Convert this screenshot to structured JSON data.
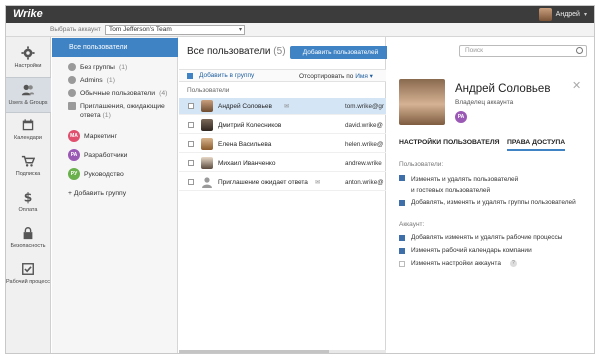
{
  "app": {
    "logo": "Wrike",
    "user_name": "Андрей",
    "account_label": "Выбрать аккаунт",
    "account_value": "Tom Jefferson's Team",
    "search_placeholder": "Поиск"
  },
  "nav": [
    {
      "label": "Настройки",
      "icon": "gear-icon"
    },
    {
      "label": "Users & Groups",
      "icon": "users-icon"
    },
    {
      "label": "Календари",
      "icon": "calendar-icon"
    },
    {
      "label": "Подписка",
      "icon": "cart-icon"
    },
    {
      "label": "Оплата",
      "icon": "dollar-icon"
    },
    {
      "label": "Безопасность",
      "icon": "lock-icon"
    },
    {
      "label": "Рабочий процесс",
      "icon": "checkbox-icon"
    }
  ],
  "groups": {
    "all": "Все пользователи",
    "items": [
      {
        "label": "Без группы",
        "count": "(1)"
      },
      {
        "label": "Admins",
        "count": "(1)"
      },
      {
        "label": "Обычные пользователи",
        "count": "(4)"
      },
      {
        "label": "Приглашения, ожидающие",
        "label2": "ответа",
        "count": "(1)"
      }
    ],
    "named": [
      {
        "badge": "МА",
        "label": "Маркетинг",
        "color": "#e0506e"
      },
      {
        "badge": "РА",
        "label": "Разработчики",
        "color": "#9b59b6"
      },
      {
        "badge": "РУ",
        "label": "Руководство",
        "color": "#6ab04c"
      }
    ],
    "add": "+ Добавить группу"
  },
  "users": {
    "title": "Все пользователи",
    "count": "(5)",
    "add_button": "Добавить пользователей",
    "add_to_group": "Добавить в группу",
    "sort_label": "Отсортировать по",
    "sort_value": "Имя ▾",
    "list_header": "Пользователи",
    "rows": [
      {
        "name": "Андрей Соловьев",
        "email": "tom.wrike@gr",
        "mail": "✉"
      },
      {
        "name": "Дмитрий Колесников",
        "email": "david.wrike@",
        "mail": ""
      },
      {
        "name": "Елена Васильева",
        "email": "helen.wrike@",
        "mail": ""
      },
      {
        "name": "Михаил Иванченко",
        "email": "andrew.wrike",
        "mail": ""
      },
      {
        "name": "Приглашение ожидает ответа",
        "email": "anton.wrike@",
        "mail": "✉"
      }
    ]
  },
  "detail": {
    "name": "Андрей Соловьев",
    "role": "Владелец аккаунта",
    "badge": "РА",
    "badge_color": "#9b59b6",
    "tab_settings": "НАСТРОЙКИ ПОЛЬЗОВАТЕЛЯ",
    "tab_access": "ПРАВА ДОСТУПА",
    "users_section": "Пользователи:",
    "account_section": "Аккаунт:",
    "user_perms": [
      {
        "line1": "Изменять и удалять пользователей",
        "line2": "и гостевых пользователей",
        "on": true
      },
      {
        "line1": "Добавлять, изменять и удалять группы пользователей",
        "line2": "",
        "on": true
      }
    ],
    "account_perms": [
      {
        "text": "Добавлять изменять и удалять рабочие процессы",
        "on": true
      },
      {
        "text": "Изменять рабочий календарь компании",
        "on": true
      },
      {
        "text": "Изменять настройки аккаунта",
        "on": false
      }
    ],
    "help": "?"
  }
}
